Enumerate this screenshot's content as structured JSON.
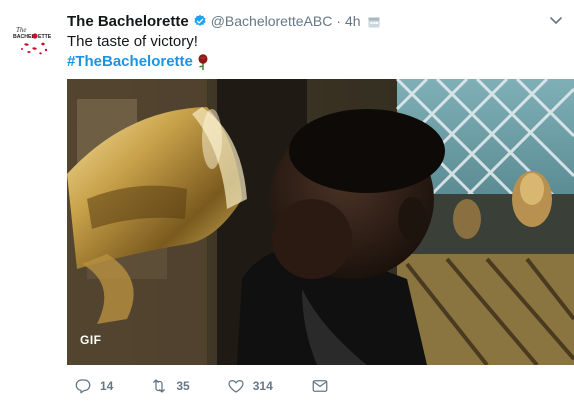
{
  "tweet": {
    "author_name": "The Bachelorette",
    "handle": "@BacheloretteABC",
    "separator": "·",
    "time": "4h",
    "text": "The taste of victory!",
    "hashtag": "#TheBachelorette",
    "media_badge": "GIF",
    "avatar_logo_text": "BACHELORETTE"
  },
  "actions": {
    "reply_count": "14",
    "retweet_count": "35",
    "like_count": "314"
  },
  "icons": {
    "verified": "verified-badge-icon",
    "caret": "chevron-down-icon",
    "reply": "reply-icon",
    "retweet": "retweet-icon",
    "like": "heart-icon",
    "mail": "direct-message-icon"
  },
  "colors": {
    "link": "#1b95e0",
    "muted": "#657786",
    "verified": "#1da1f2",
    "rose_red": "#c8102e"
  }
}
